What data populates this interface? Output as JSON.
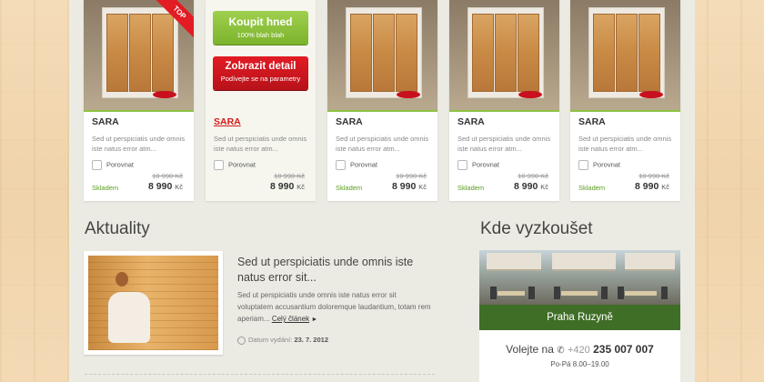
{
  "products": [
    {
      "name": "SARA",
      "desc": "Sed ut perspiciatis unde omnis iste natus error atm...",
      "compare": "Porovnat",
      "old_price": "10 990 Kč",
      "stock": "Skladem",
      "price": "8 990",
      "currency": "Kč",
      "badge": "TOP"
    },
    {
      "name": "SARA",
      "desc": "Sed ut perspiciatis unde omnis iste natus error atm...",
      "compare": "Porovnat",
      "old_price": "10 990 Kč",
      "stock": "",
      "price": "8 990",
      "currency": "Kč",
      "buy_label": "Koupit hned",
      "buy_sub": "100% blah blah",
      "detail_label": "Zobrazit detail",
      "detail_sub": "Podívejte se na parametry"
    },
    {
      "name": "SARA",
      "desc": "Sed ut perspiciatis unde omnis iste natus error atm...",
      "compare": "Porovnat",
      "old_price": "10 990 Kč",
      "stock": "Skladem",
      "price": "8 990",
      "currency": "Kč"
    },
    {
      "name": "SARA",
      "desc": "Sed ut perspiciatis unde omnis iste natus error atm...",
      "compare": "Porovnat",
      "old_price": "10 990 Kč",
      "stock": "Skladem",
      "price": "8 990",
      "currency": "Kč"
    },
    {
      "name": "SARA",
      "desc": "Sed ut perspiciatis unde omnis iste natus error atm...",
      "compare": "Porovnat",
      "old_price": "10 990 Kč",
      "stock": "Skladem",
      "price": "8 990",
      "currency": "Kč"
    }
  ],
  "news": {
    "title": "Aktuality",
    "item_title": "Sed ut perspiciatis unde omnis iste natus error sit...",
    "item_body": "Sed ut perspiciatis unde omnis iste natus error sit voluptatem accusantium doloremque laudantium, totam rem aperiam...",
    "more_label": "Celý článek",
    "date_label": "Datum vydání:",
    "date": "23. 7. 2012"
  },
  "location": {
    "title": "Kde vyzkoušet",
    "place": "Praha Ruzyně",
    "call_label": "Volejte na",
    "phone_prefix": "+420",
    "phone": "235 007 007",
    "hours": "Po-Pá 8.00–19.00"
  },
  "colors": {
    "accent_green": "#8dc240",
    "accent_red": "#e21b24",
    "dark_green": "#3f6e26"
  }
}
